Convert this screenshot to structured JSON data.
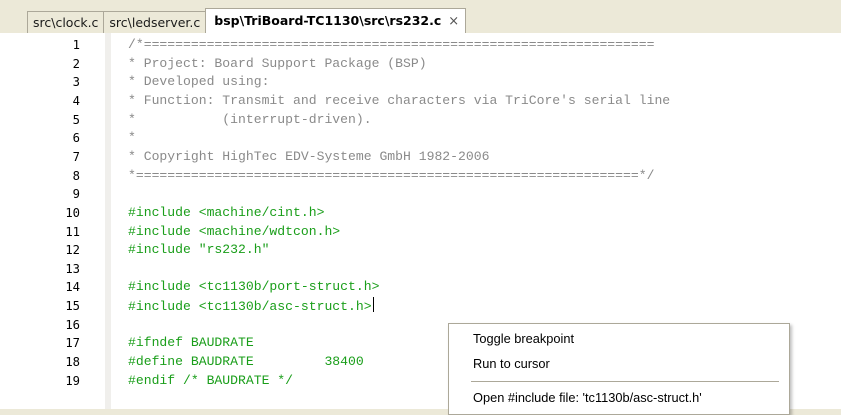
{
  "tabs": [
    {
      "label": "src\\clock.c",
      "active": false
    },
    {
      "label": "src\\ledserver.c",
      "active": false
    },
    {
      "label": "bsp\\TriBoard-TC1130\\src\\rs232.c",
      "active": true,
      "close": "×"
    }
  ],
  "editor": {
    "lines": [
      {
        "n": "1",
        "text": "/*=================================================================",
        "kind": "comment"
      },
      {
        "n": "2",
        "text": "* Project: Board Support Package (BSP)",
        "kind": "comment"
      },
      {
        "n": "3",
        "text": "* Developed using:",
        "kind": "comment"
      },
      {
        "n": "4",
        "text": "* Function: Transmit and receive characters via TriCore's serial line",
        "kind": "comment"
      },
      {
        "n": "5",
        "text": "*           (interrupt-driven).",
        "kind": "comment"
      },
      {
        "n": "6",
        "text": "*",
        "kind": "comment"
      },
      {
        "n": "7",
        "text": "* Copyright HighTec EDV-Systeme GmbH 1982-2006",
        "kind": "comment"
      },
      {
        "n": "8",
        "text": "*================================================================*/",
        "kind": "comment"
      },
      {
        "n": "9",
        "text": "",
        "kind": "plain"
      },
      {
        "n": "10",
        "text": "#include <machine/cint.h>",
        "kind": "pre"
      },
      {
        "n": "11",
        "text": "#include <machine/wdtcon.h>",
        "kind": "pre"
      },
      {
        "n": "12",
        "text": "#include \"rs232.h\"",
        "kind": "pre"
      },
      {
        "n": "13",
        "text": "",
        "kind": "plain"
      },
      {
        "n": "14",
        "text": "#include <tc1130b/port-struct.h>",
        "kind": "pre"
      },
      {
        "n": "15",
        "text": "#include <tc1130b/asc-struct.h>",
        "kind": "pre",
        "caret": true
      },
      {
        "n": "16",
        "text": "",
        "kind": "plain"
      },
      {
        "n": "17",
        "text": "#ifndef BAUDRATE",
        "kind": "pre"
      },
      {
        "n": "18",
        "text": "#define BAUDRATE         38400",
        "kind": "pre"
      },
      {
        "n": "19",
        "text": "#endif /* BAUDRATE */",
        "kind": "pre"
      }
    ]
  },
  "context_menu": {
    "items": [
      {
        "label": "Toggle breakpoint"
      },
      {
        "label": "Run to cursor"
      },
      {
        "label": "Open #include file: 'tc1130b/asc-struct.h'"
      }
    ]
  }
}
